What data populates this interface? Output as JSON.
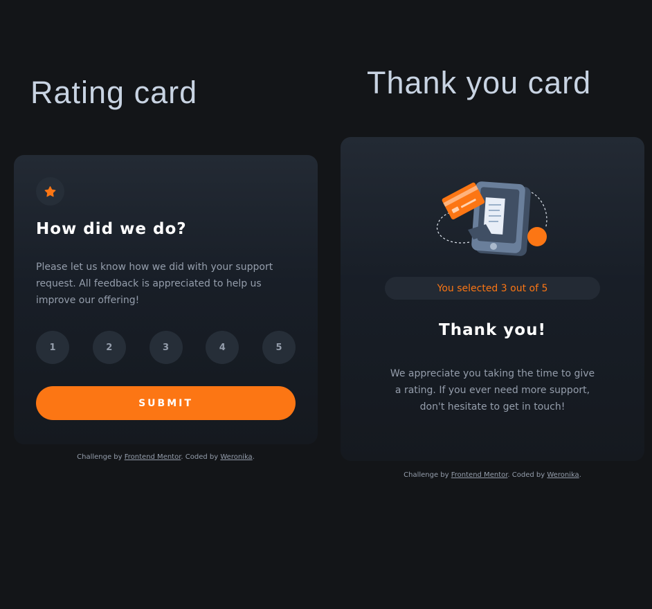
{
  "headings": {
    "rating": "Rating card",
    "thanks": "Thank you card"
  },
  "rating_card": {
    "icon": "star-icon",
    "title": "How did we do?",
    "text": "Please let us know how we did with your support request. All feedback is appreciated to help us improve our offering!",
    "ratings": [
      "1",
      "2",
      "3",
      "4",
      "5"
    ],
    "submit_label": "SUBMIT"
  },
  "thanks_card": {
    "illustration": "payment-phone-illustration",
    "selected_text": "You selected 3 out of 5",
    "title": "Thank you!",
    "text": "We appreciate you taking the time to give a rating. If you ever need more support, don't hesitate to get in touch!"
  },
  "attribution": {
    "prefix": "Challenge by ",
    "link1": "Frontend Mentor",
    "middle": ". Coded by ",
    "link2": "Weronika",
    "suffix": "."
  },
  "colors": {
    "accent": "#fc7614",
    "background": "#131518",
    "card": "#1e252e",
    "muted_text": "#959eac",
    "button_bg": "#262e38"
  }
}
